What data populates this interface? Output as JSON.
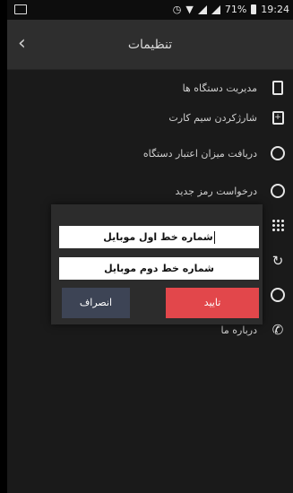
{
  "status_bar": {
    "battery": "71%",
    "time": "19:24"
  },
  "toolbar": {
    "back_icon": "chevron-left-icon",
    "title": "تنظیمات"
  },
  "menu": {
    "items": [
      {
        "label": "مدیریت دستگاه ها",
        "icon": "phone-icon"
      },
      {
        "label": "شارژکردن سیم کارت",
        "icon": "sim-charge-icon"
      },
      {
        "label": "دریافت میزان اعتبار دستگاه",
        "icon": "credit-check-icon"
      },
      {
        "label": "درخواست رمز جدید",
        "icon": "key-icon"
      },
      {
        "label": "",
        "icon": "dial-pad-icon"
      },
      {
        "label": "",
        "icon": "refresh-icon"
      },
      {
        "label": "",
        "icon": "globe-icon"
      },
      {
        "label": "درباره ما",
        "icon": "phone-call-icon"
      }
    ]
  },
  "dialog": {
    "field1_value": "شماره خط اول موبایل",
    "field2_value": "شماره خط دوم موبایل",
    "cancel_label": "انصراف",
    "confirm_label": "تایید",
    "confirm_color": "#e2474b",
    "cancel_color": "#3d4455"
  }
}
